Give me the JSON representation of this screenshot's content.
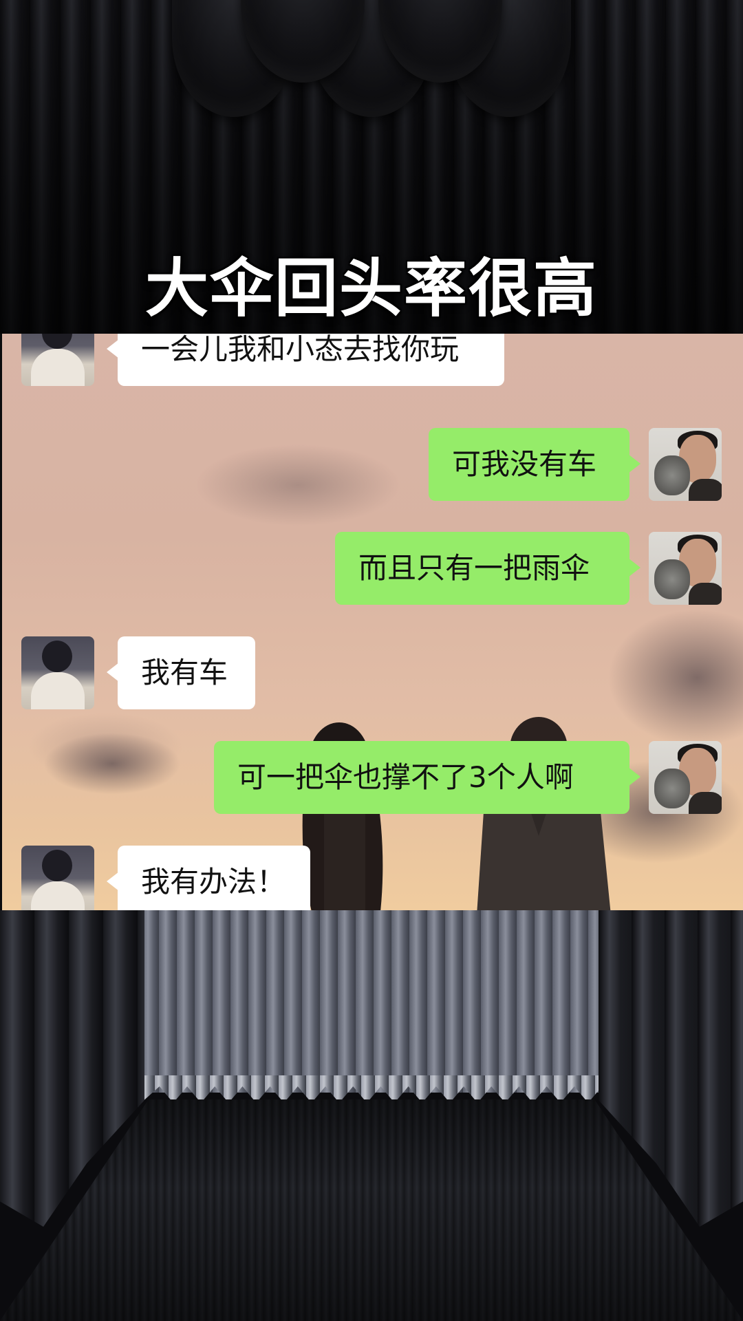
{
  "title": "大伞回头率很高",
  "chat": {
    "messages": [
      {
        "side": "left",
        "text": "一会儿我和小态去找你玩"
      },
      {
        "side": "right",
        "text": "可我没有车"
      },
      {
        "side": "right",
        "text": "而且只有一把雨伞"
      },
      {
        "side": "left",
        "text": "我有车"
      },
      {
        "side": "right",
        "text": "可一把伞也撑不了3个人啊"
      },
      {
        "side": "left",
        "text": "我有办法！"
      }
    ]
  },
  "colors": {
    "bubble_self": "#95ec69",
    "bubble_other": "#ffffff",
    "title_text": "#ffffff"
  }
}
